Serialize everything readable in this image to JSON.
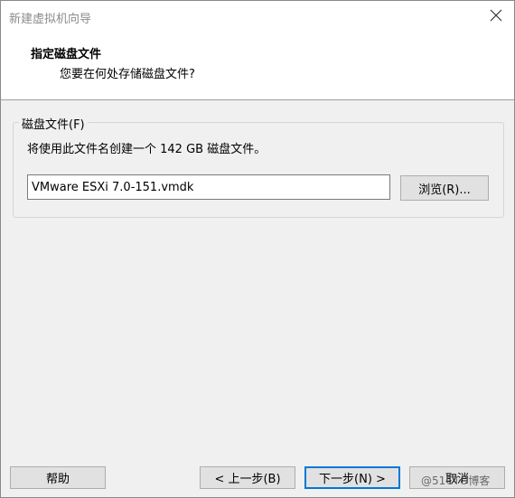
{
  "window": {
    "title": "新建虚拟机向导"
  },
  "header": {
    "title": "指定磁盘文件",
    "subtitle": "您要在何处存储磁盘文件?"
  },
  "disk_file": {
    "legend": "磁盘文件(F)",
    "description": "将使用此文件名创建一个 142 GB 磁盘文件。",
    "filename": "VMware ESXi 7.0-151.vmdk",
    "browse_label": "浏览(R)..."
  },
  "footer": {
    "help_label": "帮助",
    "back_label": "< 上一步(B)",
    "next_label": "下一步(N) >",
    "cancel_label": "取消"
  },
  "watermark": "@51CTO博客",
  "icons": {
    "close": "close-icon"
  }
}
